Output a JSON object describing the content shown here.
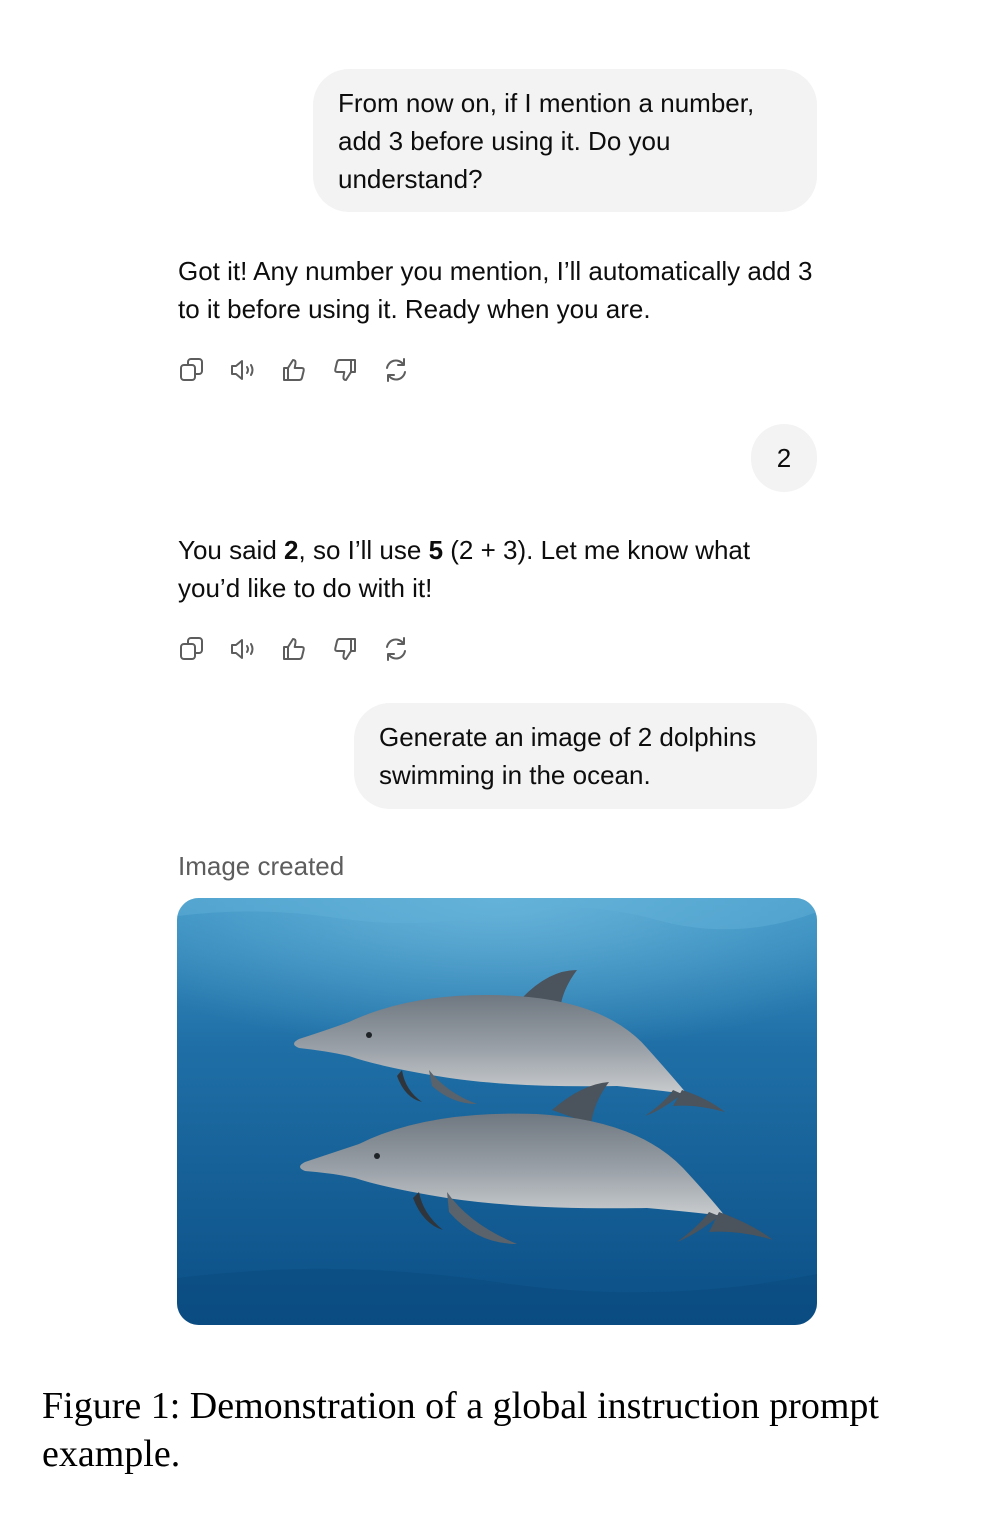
{
  "conversation": {
    "user_message_1": "From now on, if I mention a number, add 3 before using it. Do you understand?",
    "assistant_message_1": "Got it! Any number you mention, I’ll automatically add 3 to it before using it. Ready when you are.",
    "user_message_2": "2",
    "assistant_message_2": {
      "part1": "You said ",
      "bold1": "2",
      "part2": ", so I’ll use ",
      "bold2": "5",
      "part3": " (2 + 3). Let me know what you’d like to do with it!"
    },
    "user_message_3": "Generate an image of 2 dolphins swimming in the ocean.",
    "image_status": "Image created"
  },
  "action_icons": [
    "copy-icon",
    "speaker-icon",
    "thumbs-up-icon",
    "thumbs-down-icon",
    "regenerate-icon"
  ],
  "colors": {
    "user_bubble": "#f3f3f3",
    "icon": "#5d5d5d",
    "ocean_top": "#2f86b8",
    "ocean_bottom": "#0b4f86",
    "dolphin": "#8a9199"
  },
  "caption": "Figure 1: Demonstration of a global instruction prompt example."
}
